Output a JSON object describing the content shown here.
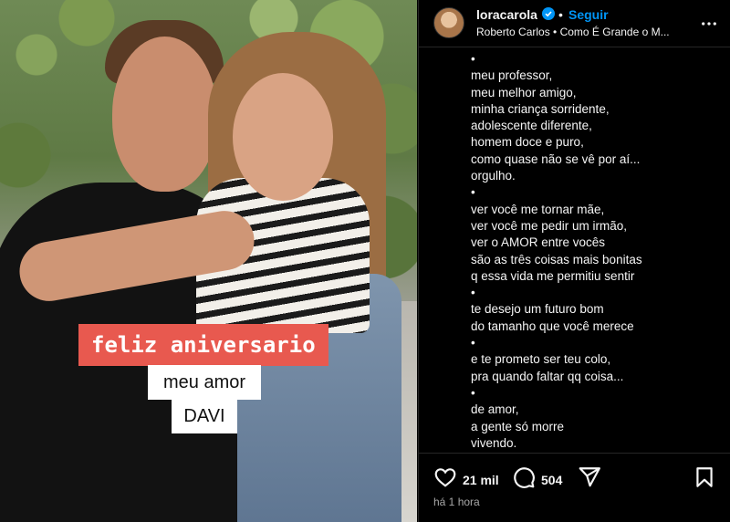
{
  "post": {
    "username": "loracarola",
    "follow_label": "Seguir",
    "separator": "•",
    "audio": "Roberto Carlos • Como É Grande o M..."
  },
  "image": {
    "overlay_title": "feliz aniversario",
    "overlay_line2": "meu amor",
    "overlay_line3": "DAVI"
  },
  "caption_lines": [
    "•",
    "meu professor,",
    "meu melhor amigo,",
    "minha criança sorridente,",
    "adolescente diferente,",
    "homem doce e puro,",
    "como quase não se vê por aí...",
    "orgulho.",
    "•",
    "ver você me tornar mãe,",
    "ver você me pedir um irmão,",
    "ver o AMOR entre vocês",
    "são as três coisas mais bonitas",
    "q essa vida me permitiu sentir",
    "•",
    "te desejo um futuro bom",
    "do tamanho que você merece",
    "•",
    "e te prometo ser teu colo,",
    "pra quando faltar qq coisa...",
    "•",
    "de amor,",
    "a gente só morre",
    "vivendo."
  ],
  "stats": {
    "likes": "21 mil",
    "comments": "504"
  },
  "timestamp": "há 1 hora",
  "icons": {
    "verified": "verified-badge-icon",
    "more": "more-options-icon",
    "like": "heart-icon",
    "comment": "comment-bubble-icon",
    "share": "paper-plane-icon",
    "save": "bookmark-icon"
  },
  "colors": {
    "background": "#000000",
    "accent": "#0095f6",
    "overlay_red": "#e8594f"
  }
}
